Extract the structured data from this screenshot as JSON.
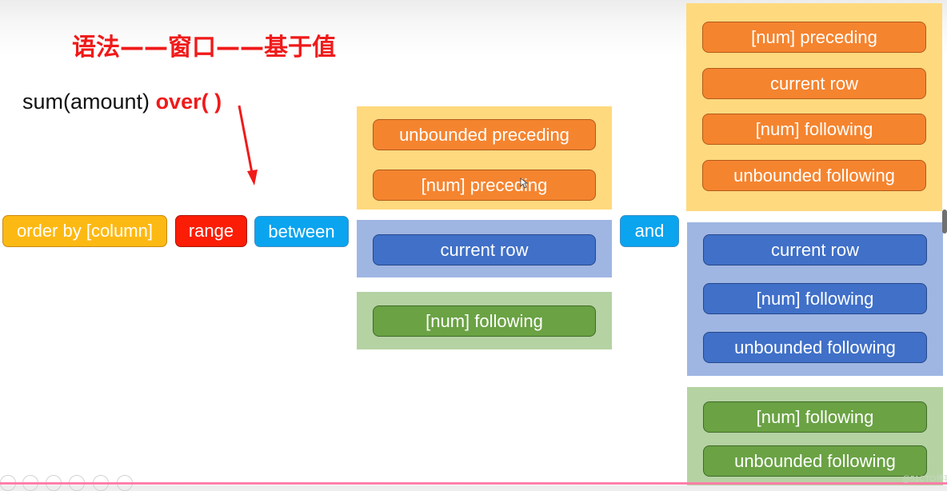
{
  "slide": {
    "title": "语法——窗口——基于值",
    "formula": {
      "prefix": "sum(amount) ",
      "keyword": "over(",
      "gap": " ",
      "suffix": ")"
    },
    "arrow": "arrow-down",
    "chain": {
      "order_by": "order by [column]",
      "range": "range",
      "between": "between",
      "and": "and"
    },
    "start_groups": [
      {
        "color": "orange",
        "items": [
          "unbounded preceding",
          "[num] preceding"
        ]
      },
      {
        "color": "blue",
        "items": [
          "current row"
        ]
      },
      {
        "color": "green",
        "items": [
          "[num] following"
        ]
      }
    ],
    "end_groups": [
      {
        "color": "orange",
        "items": [
          "[num] preceding",
          "current row",
          "[num] following",
          "unbounded following"
        ]
      },
      {
        "color": "blue",
        "items": [
          "current row",
          "[num] following",
          "unbounded following"
        ]
      },
      {
        "color": "green",
        "items": [
          "[num] following",
          "unbounded following"
        ]
      }
    ],
    "watermark": "@51CTO博客"
  },
  "colors": {
    "title_red": "#f01a1a",
    "order_by_yellow": "#fdb913",
    "range_red": "#fb1d05",
    "between_and_sky": "#0aa4ef",
    "orange_chip": "#f5842f",
    "orange_panel": "#ffd97e",
    "blue_chip": "#4070c8",
    "blue_panel": "#9fb6e3",
    "green_chip": "#6aa244",
    "green_panel": "#b5d2a3"
  },
  "player_toolbar": [
    "prev-icon",
    "next-icon",
    "pen-icon",
    "slides-icon",
    "zoom-icon",
    "more-icon"
  ]
}
